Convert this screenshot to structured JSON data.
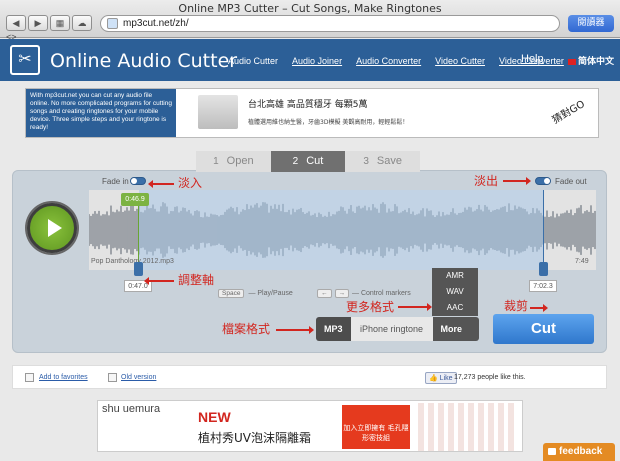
{
  "browser": {
    "window_title": "Online MP3 Cutter – Cut Songs, Make Ringtones",
    "url": "mp3cut.net/zh/",
    "reader_label": "閱讀器",
    "bookmarks_label": "<>"
  },
  "header": {
    "logo_text": "Online Audio Cutter",
    "nav": [
      "Audio Cutter",
      "Audio Joiner",
      "Audio Converter",
      "Video Cutter",
      "Video Converter"
    ],
    "help": "Help",
    "lang": "简体中文"
  },
  "ad1": {
    "text": "With mp3cut.net you can cut any audio file online. No more complicated programs for cutting songs and creating ringtones for your mobile device. Three simple steps and your ringtone is ready!",
    "headline": "台北高雄 高品質穩牙 每顆5萬",
    "sub": "植體選用維也納生醫，牙齒3D模擬 美觀高耐用，輕輕鬆鬆！",
    "cta": "猜對GO"
  },
  "steps": [
    {
      "num": "1",
      "label": "Open"
    },
    {
      "num": "2",
      "label": "Cut"
    },
    {
      "num": "3",
      "label": "Save"
    }
  ],
  "editor": {
    "fade_in": "Fade in",
    "fade_out": "Fade out",
    "cursor_time": "0:46.9",
    "filename": "Pop Danthology 2012.mp3",
    "duration": "7:49",
    "start_time": "0:47.0",
    "end_time": "7:02.3",
    "space_key": "Space",
    "play_pause": "— Play/Pause",
    "control_markers": "— Control markers",
    "formats": [
      "AMR",
      "WAV",
      "AAC"
    ],
    "mp3": "MP3",
    "iphone": "iPhone ringtone",
    "more": "More ⇕",
    "cut": "Cut"
  },
  "annotations": {
    "fade_in": "淡入",
    "fade_out": "淡出",
    "adjust": "調整軸",
    "more_formats": "更多格式",
    "trim": "裁剪",
    "file_format": "檔案格式"
  },
  "footer": {
    "favorites": "Add to favorites",
    "old_version": "Old version",
    "like": "Like",
    "like_count": "17,273 people like this."
  },
  "ad2": {
    "brand": "shu uemura",
    "new": "NEW",
    "product": "植村秀UV泡沫隔離霜",
    "promo": "加入立即擁有 毛孔隱形密技組"
  },
  "feedback": "feedback"
}
